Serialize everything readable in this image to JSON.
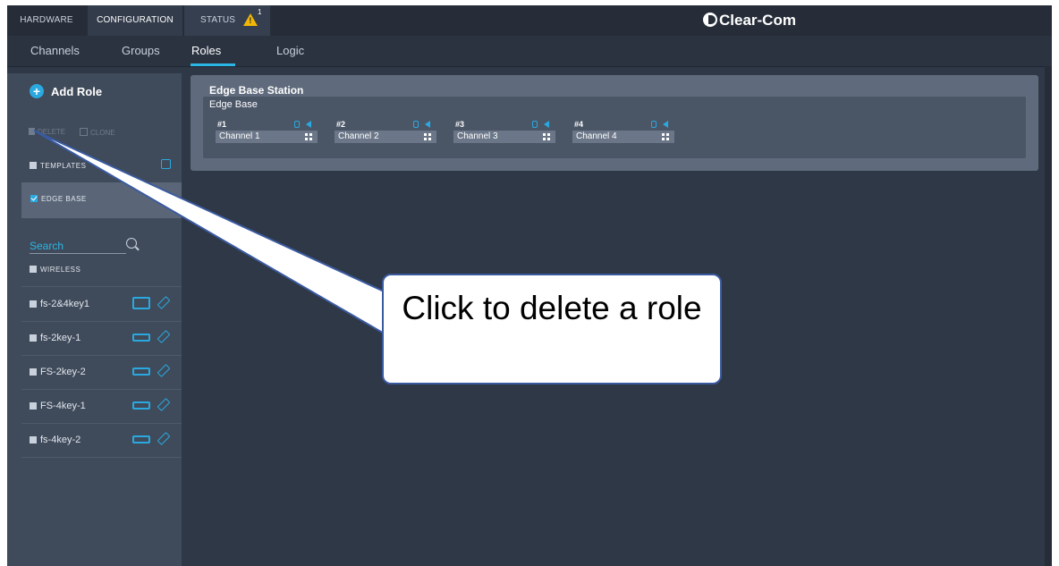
{
  "top_tabs": {
    "hardware": "HARDWARE",
    "configuration": "CONFIGURATION",
    "status": "STATUS",
    "status_count": "1"
  },
  "logo": "Clear-Com",
  "sub_tabs": {
    "channels": "Channels",
    "groups": "Groups",
    "roles": "Roles",
    "logic": "Logic"
  },
  "sidebar": {
    "add_role": "Add Role",
    "delete": "DELETE",
    "clone": "CLONE",
    "templates": "TEMPLATES",
    "edge_base": "EDGE BASE",
    "search_placeholder": "Search",
    "wireless": "WIRELESS",
    "roles": [
      {
        "label": "fs-2&4key1",
        "device": "big-device-icon"
      },
      {
        "label": "fs-2key-1",
        "device": "device-icon"
      },
      {
        "label": "FS-2key-2",
        "device": "device-icon"
      },
      {
        "label": "FS-4key-1",
        "device": "device-icon"
      },
      {
        "label": "fs-4key-2",
        "device": "device-icon"
      }
    ]
  },
  "card": {
    "title": "Edge Base Station",
    "subtitle": "Edge Base",
    "slots": [
      {
        "num": "#1",
        "label": "Channel 1"
      },
      {
        "num": "#2",
        "label": "Channel 2"
      },
      {
        "num": "#3",
        "label": "Channel 3"
      },
      {
        "num": "#4",
        "label": "Channel 4"
      }
    ]
  },
  "callout": {
    "text": "Click to delete a role"
  },
  "colors": {
    "accent": "#2bb7e5",
    "warning": "#f2b705",
    "background": "#2f3846"
  }
}
